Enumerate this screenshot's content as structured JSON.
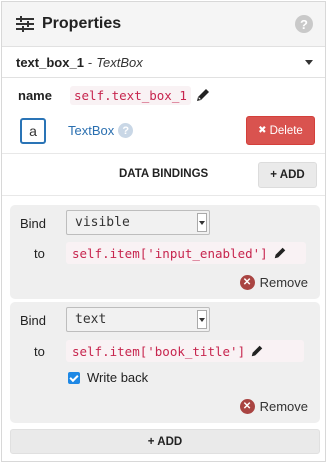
{
  "header": {
    "title": "Properties",
    "help_icon": "?"
  },
  "component": {
    "name": "text_box_1",
    "separator": "-",
    "type": "TextBox"
  },
  "name_row": {
    "label": "name",
    "value": "self.text_box_1"
  },
  "toolbox": {
    "icon_text": "a",
    "link_label": "TextBox",
    "help_icon": "?",
    "delete_label": "Delete"
  },
  "data_bindings": {
    "title": "DATA BINDINGS",
    "add_label": "+ ADD",
    "bindings": [
      {
        "bind_label": "Bind",
        "property": "visible",
        "to_label": "to",
        "expression": "self.item['input_enabled']",
        "remove_label": "Remove"
      },
      {
        "bind_label": "Bind",
        "property": "text",
        "to_label": "to",
        "expression": "self.item['book_title']",
        "writeback_label": "Write back",
        "writeback_checked": true,
        "remove_label": "Remove"
      }
    ],
    "add_bottom_label": "+ ADD"
  },
  "colors": {
    "delete": "#d9534f",
    "code_text": "#c7254e",
    "code_bg": "#f9f2f4",
    "link": "#2a6fb0",
    "remove_icon": "#a94442",
    "checkbox": "#1e88e5"
  }
}
